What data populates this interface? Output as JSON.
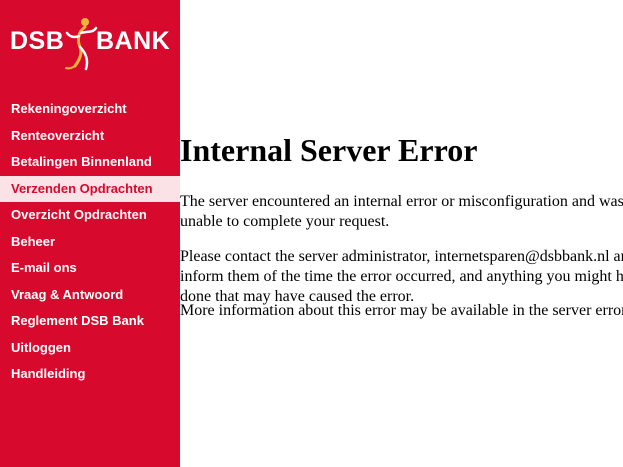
{
  "brand": {
    "left": "DSB",
    "right": "BANK",
    "colors": {
      "primary": "#d70a2e",
      "active_bg": "#fbe2e6",
      "figure_accent": "#f3b23a"
    }
  },
  "menu": [
    {
      "label": "Rekeningoverzicht",
      "active": false
    },
    {
      "label": "Renteoverzicht",
      "active": false
    },
    {
      "label": "Betalingen Binnenland",
      "active": false
    },
    {
      "label": "Verzenden Opdrachten",
      "active": true
    },
    {
      "label": "Overzicht Opdrachten",
      "active": false
    },
    {
      "label": "Beheer",
      "active": false
    },
    {
      "label": "E-mail ons",
      "active": false
    },
    {
      "label": "Vraag & Antwoord",
      "active": false
    },
    {
      "label": "Reglement DSB Bank",
      "active": false
    },
    {
      "label": "Uitloggen",
      "active": false
    },
    {
      "label": "Handleiding",
      "active": false
    }
  ],
  "error": {
    "title": "Internal Server Error",
    "paragraph1": "The server encountered an internal error or misconfiguration and was unable to complete your request.",
    "paragraph2": "Please contact the server administrator, internetsparen@dsbbank.nl and inform them of the time the error occurred, and anything you might have done that may have caused the error.",
    "paragraph3": "More information about this error may be available in the server error log."
  }
}
